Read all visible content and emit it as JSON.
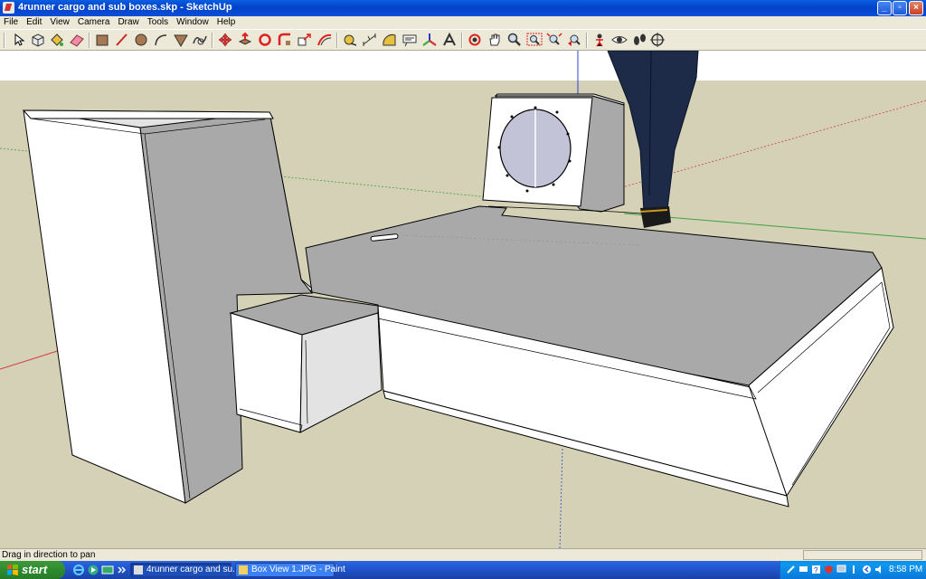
{
  "window": {
    "title": "4runner cargo and sub boxes.skp - SketchUp",
    "controls": [
      "minimize",
      "maximize",
      "close"
    ]
  },
  "menu": [
    "File",
    "Edit",
    "View",
    "Camera",
    "Draw",
    "Tools",
    "Window",
    "Help"
  ],
  "toolbar": {
    "tools": [
      "select-icon",
      "component-icon",
      "paint-bucket-icon",
      "eraser-icon",
      "rectangle-icon",
      "line-icon",
      "circle-icon",
      "arc-icon",
      "polygon-icon",
      "freehand-icon",
      "move-icon",
      "push-pull-icon",
      "rotate-icon",
      "follow-me-icon",
      "scale-icon",
      "offset-icon",
      "tape-measure-icon",
      "dimension-icon",
      "protractor-icon",
      "text-icon",
      "axes-icon",
      "3d-text-icon",
      "orbit-icon",
      "pan-icon",
      "zoom-icon",
      "zoom-window-icon",
      "zoom-extents-icon",
      "previous-view-icon",
      "position-camera-icon",
      "look-around-icon",
      "walk-icon",
      "section-plane-icon"
    ]
  },
  "status": {
    "message": "Drag in direction to pan",
    "measurements": ""
  },
  "taskbar": {
    "start_label": "start",
    "tasks": [
      {
        "label": "4runner cargo and su...",
        "active": true
      },
      {
        "label": "Box View 1.JPG - Paint",
        "active": false
      }
    ],
    "clock": "8:58 PM"
  },
  "colors": {
    "sky": "#ffffff",
    "ground": "#d4d1b7",
    "face_light": "#ffffff",
    "face_gray": "#a9a9a9",
    "face_mid": "#e3e3e3",
    "axis_red": "#d04040",
    "axis_green": "#3fa03f",
    "axis_blue": "#3040d0",
    "xp_blue": "#245edb",
    "start_green": "#2e8a2e"
  }
}
